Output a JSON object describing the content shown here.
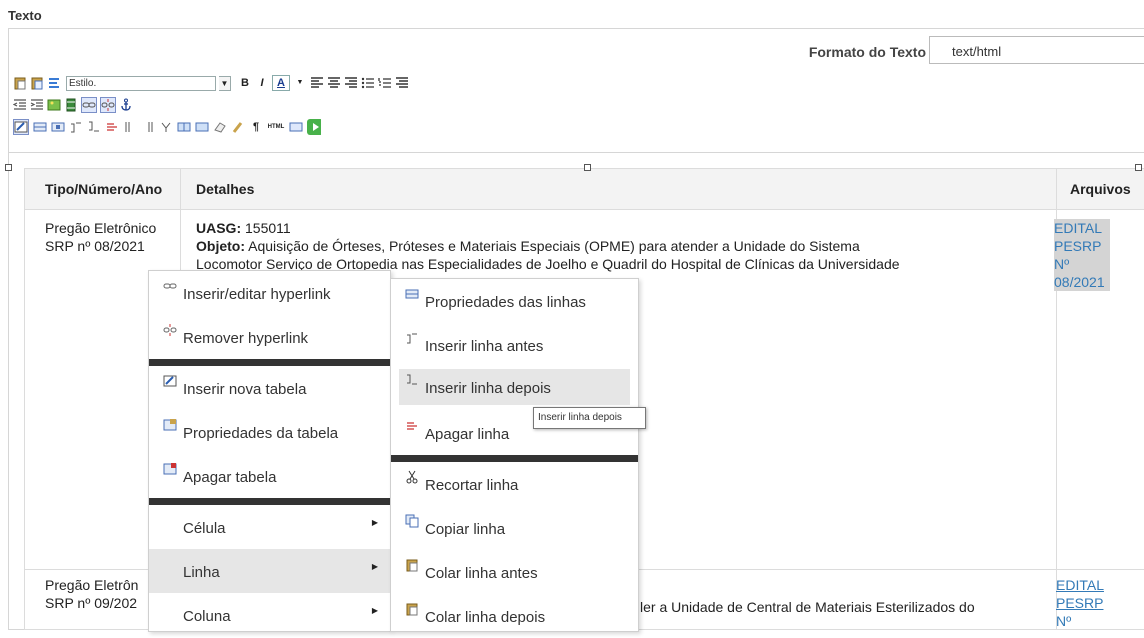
{
  "section_title": "Texto",
  "format": {
    "label": "Formato do Texto",
    "value": "text/html"
  },
  "toolbar": {
    "style_placeholder": "Estilo.",
    "bold": "B",
    "italic": "I",
    "font_color": "A",
    "html_label": "HTML",
    "pilcrow": "¶"
  },
  "table": {
    "headers": [
      "Tipo/Número/Ano",
      "Detalhes",
      "Arquivos"
    ],
    "rows": [
      {
        "tipo_line1": "Pregão Eletrônico",
        "tipo_line2": "SRP nº 08/2021",
        "uasg_label": "UASG:",
        "uasg_value": "155011",
        "objeto_label": "Objeto:",
        "objeto_line1": "Aquisição de Órteses, Próteses e Materiais Especiais (OPME) para atender a Unidade do Sistema",
        "objeto_line2": "Locomotor Serviço de Ortopedia nas Especialidades de Joelho e Quadril do Hospital de Clínicas da Universidade",
        "files": [
          "EDITAL",
          "PESRP",
          "Nº",
          "08/2021"
        ]
      },
      {
        "tipo_line1": "Pregão Eletrôn",
        "tipo_line2": "SRP nº 09/202",
        "objeto_visible": "ler a Unidade de Central de Materiais Esterilizados do",
        "files": [
          "EDITAL",
          "PESRP",
          "Nº"
        ]
      }
    ]
  },
  "context_menu": {
    "items": [
      {
        "label": "Inserir/editar hyperlink",
        "icon": "link-icon"
      },
      {
        "label": "Remover hyperlink",
        "icon": "unlink-icon"
      },
      {
        "label": "Inserir nova tabela",
        "icon": "table-insert-icon"
      },
      {
        "label": "Propriedades da tabela",
        "icon": "table-properties-icon"
      },
      {
        "label": "Apagar tabela",
        "icon": "table-delete-icon"
      },
      {
        "label": "Célula",
        "icon": ""
      },
      {
        "label": "Linha",
        "icon": ""
      },
      {
        "label": "Coluna",
        "icon": ""
      }
    ]
  },
  "submenu": {
    "items": [
      {
        "label": "Propriedades das linhas",
        "icon": "row-properties-icon"
      },
      {
        "label": "Inserir linha antes",
        "icon": "row-insert-before-icon"
      },
      {
        "label": "Inserir linha depois",
        "icon": "row-insert-after-icon"
      },
      {
        "label": "Apagar linha",
        "icon": "row-delete-icon"
      },
      {
        "label": "Recortar linha",
        "icon": "cut-icon"
      },
      {
        "label": "Copiar linha",
        "icon": "copy-icon"
      },
      {
        "label": "Colar linha antes",
        "icon": "paste-icon"
      },
      {
        "label": "Colar linha depois",
        "icon": "paste-icon"
      }
    ]
  },
  "tooltip": "Inserir linha depois",
  "colors": {
    "link": "#337ab7",
    "menu_highlight": "#e6e6e6",
    "file_highlight": "#d4d4d4",
    "separator": "#333333"
  }
}
